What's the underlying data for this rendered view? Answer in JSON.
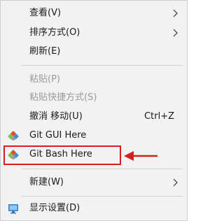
{
  "menu": {
    "items": [
      {
        "label": "查看(V)",
        "has_submenu": true,
        "enabled": true
      },
      {
        "label": "排序方式(O)",
        "has_submenu": true,
        "enabled": true
      },
      {
        "label": "刷新(E)",
        "enabled": true
      },
      {
        "label": "粘贴(P)",
        "enabled": false
      },
      {
        "label": "粘贴快捷方式(S)",
        "enabled": false
      },
      {
        "label": "撤消 移动(U)",
        "shortcut": "Ctrl+Z",
        "enabled": true
      },
      {
        "label": "Git GUI Here",
        "icon": "git-diamond-icon",
        "enabled": true
      },
      {
        "label": "Git Bash Here",
        "icon": "git-diamond-icon",
        "enabled": true,
        "annotated": true
      },
      {
        "label": "新建(W)",
        "has_submenu": true,
        "enabled": true
      },
      {
        "label": "显示设置(D)",
        "icon": "display-monitor-icon",
        "enabled": true
      }
    ]
  },
  "colors": {
    "menu_background": "#f2f2f2",
    "annotation_red": "#d61f1f",
    "disabled_text": "#9a9a9a"
  }
}
